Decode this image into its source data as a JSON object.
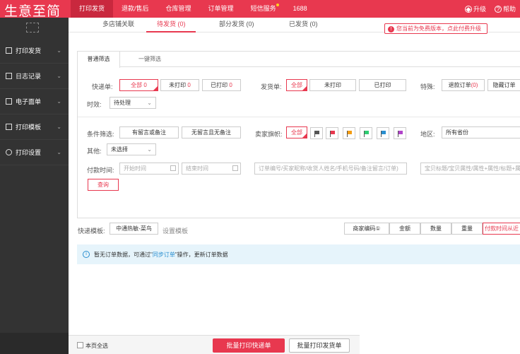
{
  "app": {
    "logo": "生意至简"
  },
  "topnav": {
    "items": [
      "打印发货",
      "退款/售后",
      "仓库管理",
      "订单管理",
      "短信服务",
      "1688"
    ],
    "active": "打印发货",
    "upgrade": "升级",
    "help": "帮助"
  },
  "sidebar": {
    "items": [
      "打印发货",
      "日志记录",
      "电子面单",
      "打印模板",
      "打印设置"
    ]
  },
  "subtabs": {
    "items": [
      "多店铺关联",
      "待发货 (0)",
      "部分发货 (0)",
      "已发货 (0)"
    ],
    "active": "待发货 (0)"
  },
  "notice": "您当前为免费版本，点此付费升级",
  "filter": {
    "tabs": [
      "普通筛选",
      "一键筛选"
    ],
    "express_label": "快递单:",
    "express_all": "全部",
    "express_all_count": "0",
    "express_unprinted": "未打印",
    "express_unprinted_count": "0",
    "express_printed": "已打印",
    "express_printed_count": "0",
    "invoice_label": "发货单:",
    "invoice_all": "全部",
    "invoice_unprinted": "未打印",
    "invoice_printed": "已打印",
    "special_label": "特殊:",
    "refund_btn": "退款订单",
    "refund_count": "(0)",
    "hidden_btn": "隐藏订单",
    "aging_label": "时效:",
    "aging_value": "待处理",
    "condition_label": "条件筛选:",
    "cond_has_note": "有留言或备注",
    "cond_no_note": "无留言且无备注",
    "seller_flag_label": "卖家旗帜:",
    "seller_flag_all": "全部",
    "flag_colors": [
      "#555555",
      "#e8384f",
      "#f39c12",
      "#2ecc71",
      "#2a8fd0",
      "#b044c9"
    ],
    "region_label": "地区:",
    "region_value": "所有省份",
    "other_label": "其他:",
    "other_value": "未选择",
    "pay_time_label": "付款时间:",
    "start_time_placeholder": "开始时间",
    "end_time_placeholder": "结束时间",
    "order_search_placeholder": "订单编号/买家昵称/收货人姓名/手机号码/备注留言/订单)",
    "product_search_placeholder": "宝贝标题/宝贝属性/属性+属性/标题+属性",
    "search_btn": "查询"
  },
  "template_row": {
    "label": "快递模板:",
    "template": "中通热敏-菜鸟",
    "settings_link": "设置模板",
    "sort_buttons": [
      "商家编码①",
      "金额",
      "数量",
      "重量",
      "付款时间从近"
    ]
  },
  "info": {
    "text_before": "暂无订单数据，可通过\"",
    "link": "同步订单",
    "text_after": "\"操作，更新订单数据"
  },
  "bottom": {
    "select_all": "本页全选",
    "batch_express": "批量打印快递单",
    "batch_invoice": "批量打印发货单"
  }
}
